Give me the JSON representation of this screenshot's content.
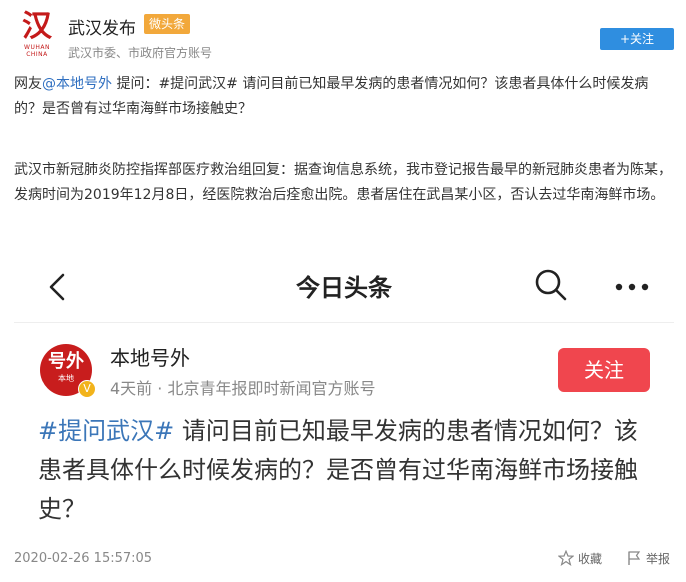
{
  "account": {
    "logo_glyph": "汉",
    "logo_en": "WUHAN CHINA",
    "name": "武汉发布",
    "badge": "微头条",
    "subtitle": "武汉市委、市政府官方账号",
    "follow_label": "+关注"
  },
  "post": {
    "p1_prefix": "网友",
    "p1_mention": "@本地号外",
    "p1_rest": " 提问：#提问武汉# 请问目前已知最早发病的患者情况如何？该患者具体什么时候发病的？是否曾有过华南海鲜市场接触史？",
    "p2": "武汉市新冠肺炎防控指挥部医疗救治组回复：据查询信息系统，我市登记报告最早的新冠肺炎患者为陈某，发病时间为2019年12月8日，经医院救治后痊愈出院。患者居住在武昌某小区，否认去过华南海鲜市场。"
  },
  "screenshot": {
    "nav_title": "今日头条",
    "avatar_line1": "号外",
    "avatar_line2": "本地",
    "verified_mark": "V",
    "source_name": "本地号外",
    "source_meta": "4天前 · 北京青年报即时新闻官方账号",
    "follow_label": "关注",
    "question_tag": "#提问武汉#",
    "question_text": " 请问目前已知最早发病的患者情况如何？该患者具体什么时候发病的？是否曾有过华南海鲜市场接触史？"
  },
  "footer": {
    "timestamp": "2020-02-26 15:57:05",
    "favorite_label": "收藏",
    "report_label": "举报"
  },
  "colors": {
    "link": "#2f6fc0",
    "follow_blue": "#2f8ee0",
    "follow_red": "#f0464e",
    "badge": "#f2a83b",
    "brand_red": "#c41a1a"
  }
}
